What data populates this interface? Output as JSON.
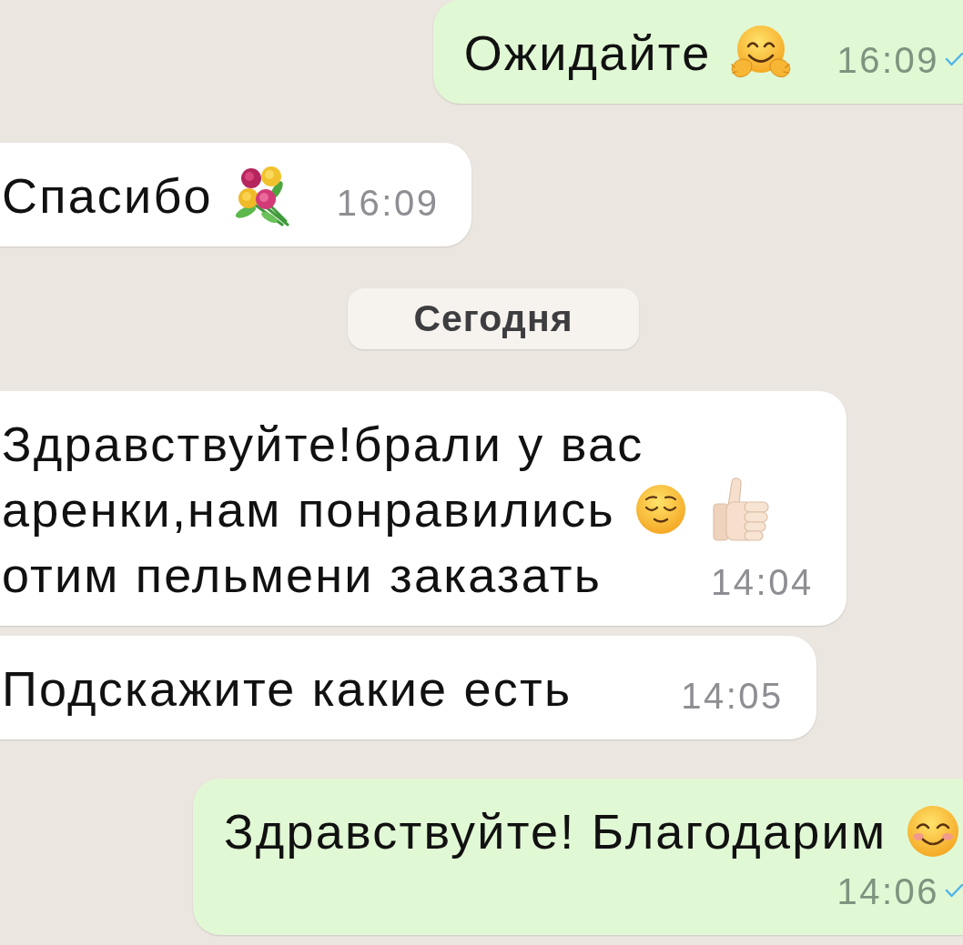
{
  "messages": [
    {
      "kind": "outgoing",
      "lines": [
        {
          "text": "Ожидайте",
          "emoji": [
            {
              "kind": "hugging-face"
            }
          ]
        }
      ],
      "time": "16:09",
      "read": true
    },
    {
      "kind": "incoming",
      "lines": [
        {
          "text": "Спасибо",
          "emoji": [
            {
              "kind": "bouquet"
            }
          ]
        }
      ],
      "time": "16:09"
    },
    {
      "kind": "date",
      "label": "Сегодня"
    },
    {
      "kind": "incoming",
      "lines": [
        {
          "text": "Здравствуйте!брали у вас"
        },
        {
          "text": "аренки,нам понравились",
          "emoji": [
            {
              "kind": "relieved-face"
            },
            {
              "kind": "thumbs-up"
            }
          ]
        },
        {
          "text": "отим пельмени заказать"
        }
      ],
      "time": "14:04"
    },
    {
      "kind": "incoming",
      "lines": [
        {
          "text": "Подскажите какие есть"
        }
      ],
      "time": "14:05"
    },
    {
      "kind": "outgoing",
      "lines": [
        {
          "text": "Здравствуйте! Благодарим",
          "emoji": [
            {
              "kind": "smiling-face"
            }
          ]
        }
      ],
      "time": "14:06",
      "read": true
    }
  ]
}
